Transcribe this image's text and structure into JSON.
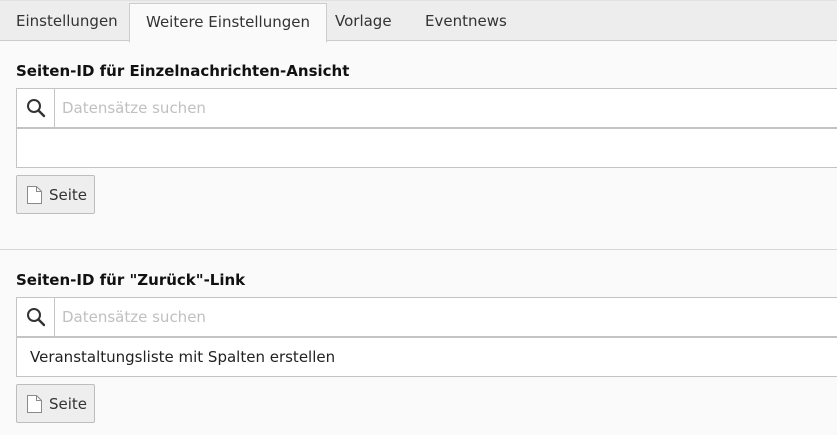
{
  "tabs": [
    {
      "label": "Einstellungen"
    },
    {
      "label": "Weitere Einstellungen"
    },
    {
      "label": "Vorlage"
    },
    {
      "label": "Eventnews"
    }
  ],
  "sections": [
    {
      "title": "Seiten-ID für Einzelnachrichten-Ansicht",
      "search_placeholder": "Datensätze suchen",
      "value": "",
      "button_label": "Seite"
    },
    {
      "title": "Seiten-ID für \"Zurück\"-Link",
      "search_placeholder": "Datensätze suchen",
      "value": "Veranstaltungsliste mit Spalten erstellen",
      "button_label": "Seite"
    }
  ]
}
